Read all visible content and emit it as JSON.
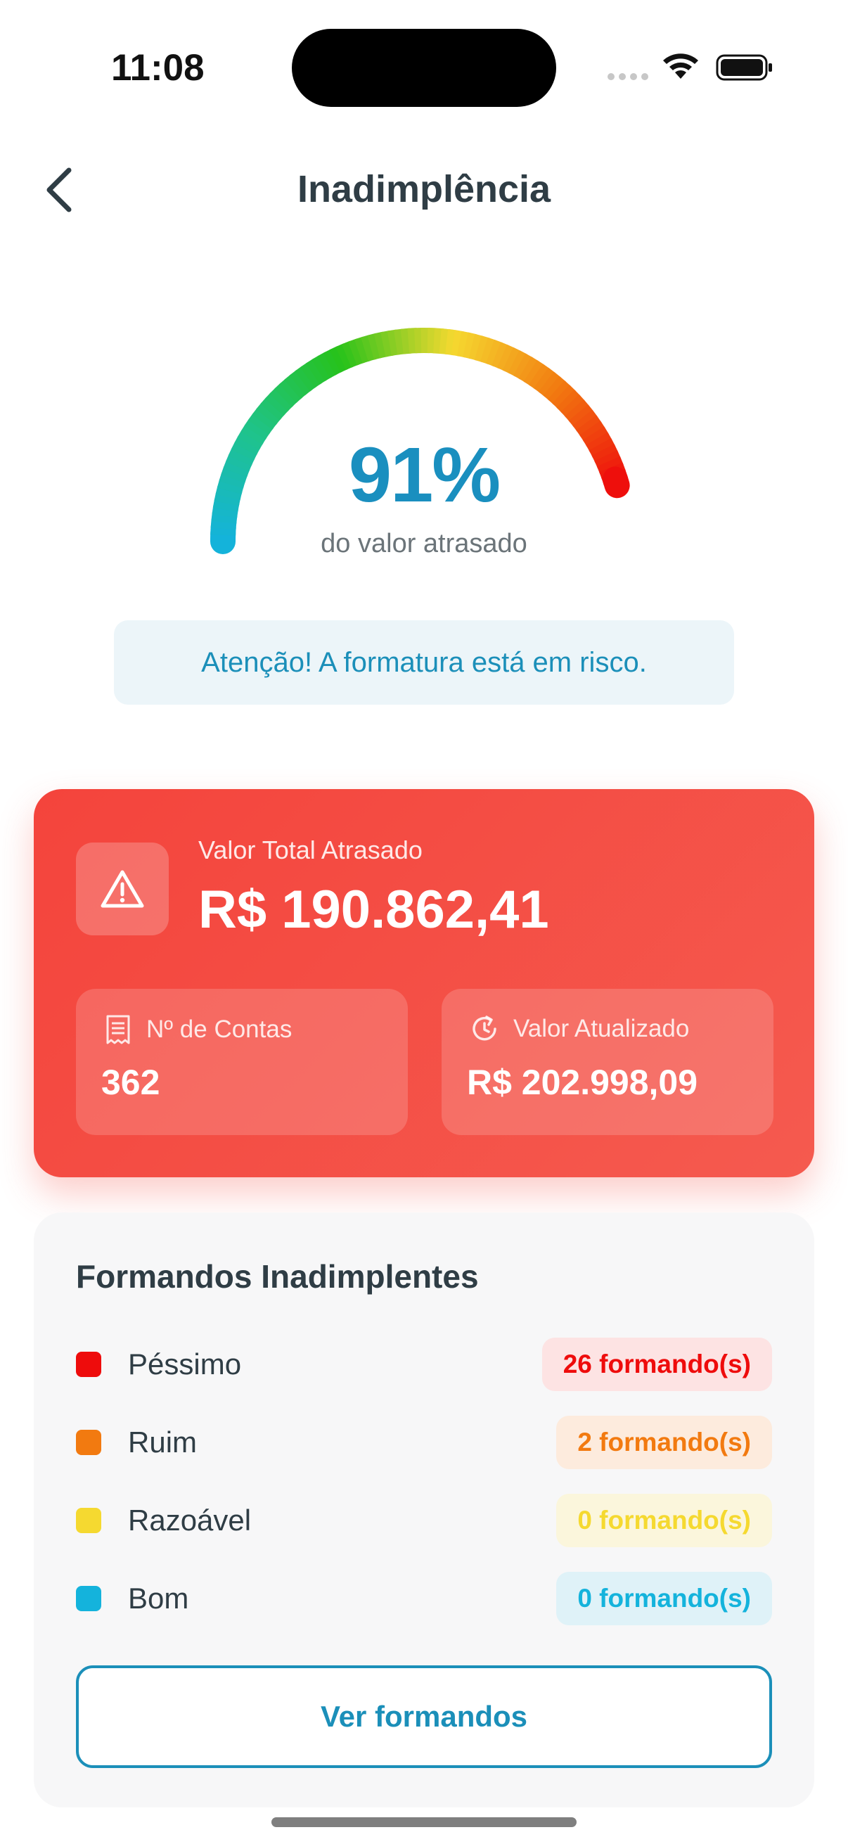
{
  "status": {
    "time": "11:08"
  },
  "nav": {
    "title": "Inadimplência"
  },
  "gauge": {
    "value_text": "91%",
    "percent": 91,
    "caption": "do valor atrasado"
  },
  "alert": {
    "text": "Atenção! A formatura está em risco."
  },
  "summary": {
    "total_label": "Valor Total Atrasado",
    "total_value": "R$ 190.862,41",
    "accounts_label": "Nº de Contas",
    "accounts_value": "362",
    "updated_label": "Valor Atualizado",
    "updated_value": "R$ 202.998,09"
  },
  "students": {
    "title": "Formandos Inadimplentes",
    "items": [
      {
        "label": "Péssimo",
        "count": "26 formando(s)",
        "color": "#ee0c0c",
        "badge_bg": "#fde3e3"
      },
      {
        "label": "Ruim",
        "count": "2 formando(s)",
        "color": "#f27a10",
        "badge_bg": "#fdebdd"
      },
      {
        "label": "Razoável",
        "count": "0 formando(s)",
        "color": "#f5d930",
        "badge_bg": "#fbf6dc"
      },
      {
        "label": "Bom",
        "count": "0 formando(s)",
        "color": "#14b3dc",
        "badge_bg": "#dff2f8"
      }
    ],
    "button_label": "Ver formandos"
  },
  "colors": {
    "accent": "#1b8fb9",
    "danger": "#f4443c"
  },
  "icons": {
    "back": "chevron-left-icon",
    "warning": "warning-triangle-icon",
    "accounts": "receipt-icon",
    "updated": "refresh-clock-icon"
  }
}
